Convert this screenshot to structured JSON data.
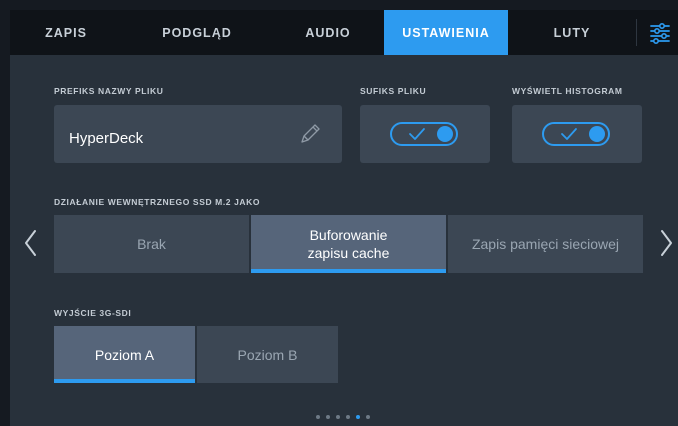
{
  "tabs": [
    {
      "label": "ZAPIS",
      "active": false
    },
    {
      "label": "PODGLĄD",
      "active": false
    },
    {
      "label": "AUDIO",
      "active": false
    },
    {
      "label": "USTAWIENIA",
      "active": true
    },
    {
      "label": "LUTY",
      "active": false
    }
  ],
  "menu": {
    "icon": "settings-sliders-icon"
  },
  "filename_prefix": {
    "label": "PREFIKS NAZWY PLIKU",
    "value": "HyperDeck",
    "icon": "pencil-icon"
  },
  "file_suffix": {
    "label": "SUFIKS PLIKU",
    "enabled": true
  },
  "histogram": {
    "label": "WYŚWIETL HISTOGRAM",
    "enabled": true
  },
  "ssd": {
    "label": "DZIAŁANIE WEWNĘTRZNEGO SSD M.2 JAKO",
    "options": [
      "Brak",
      "Buforowanie zapisu cache",
      "Zapis pamięci sieciowej"
    ],
    "selected": 1
  },
  "sdi": {
    "label": "WYJŚCIE 3G-SDI",
    "options": [
      "Poziom A",
      "Poziom B"
    ],
    "selected": 0
  },
  "nav": {
    "prev_icon": "chevron-left-icon",
    "next_icon": "chevron-right-icon"
  },
  "pagination": {
    "total": 6,
    "current": 5
  },
  "colors": {
    "accent": "#2d9bf0",
    "panel": "#28313b",
    "card": "#3c4754",
    "selected": "#56657a"
  }
}
